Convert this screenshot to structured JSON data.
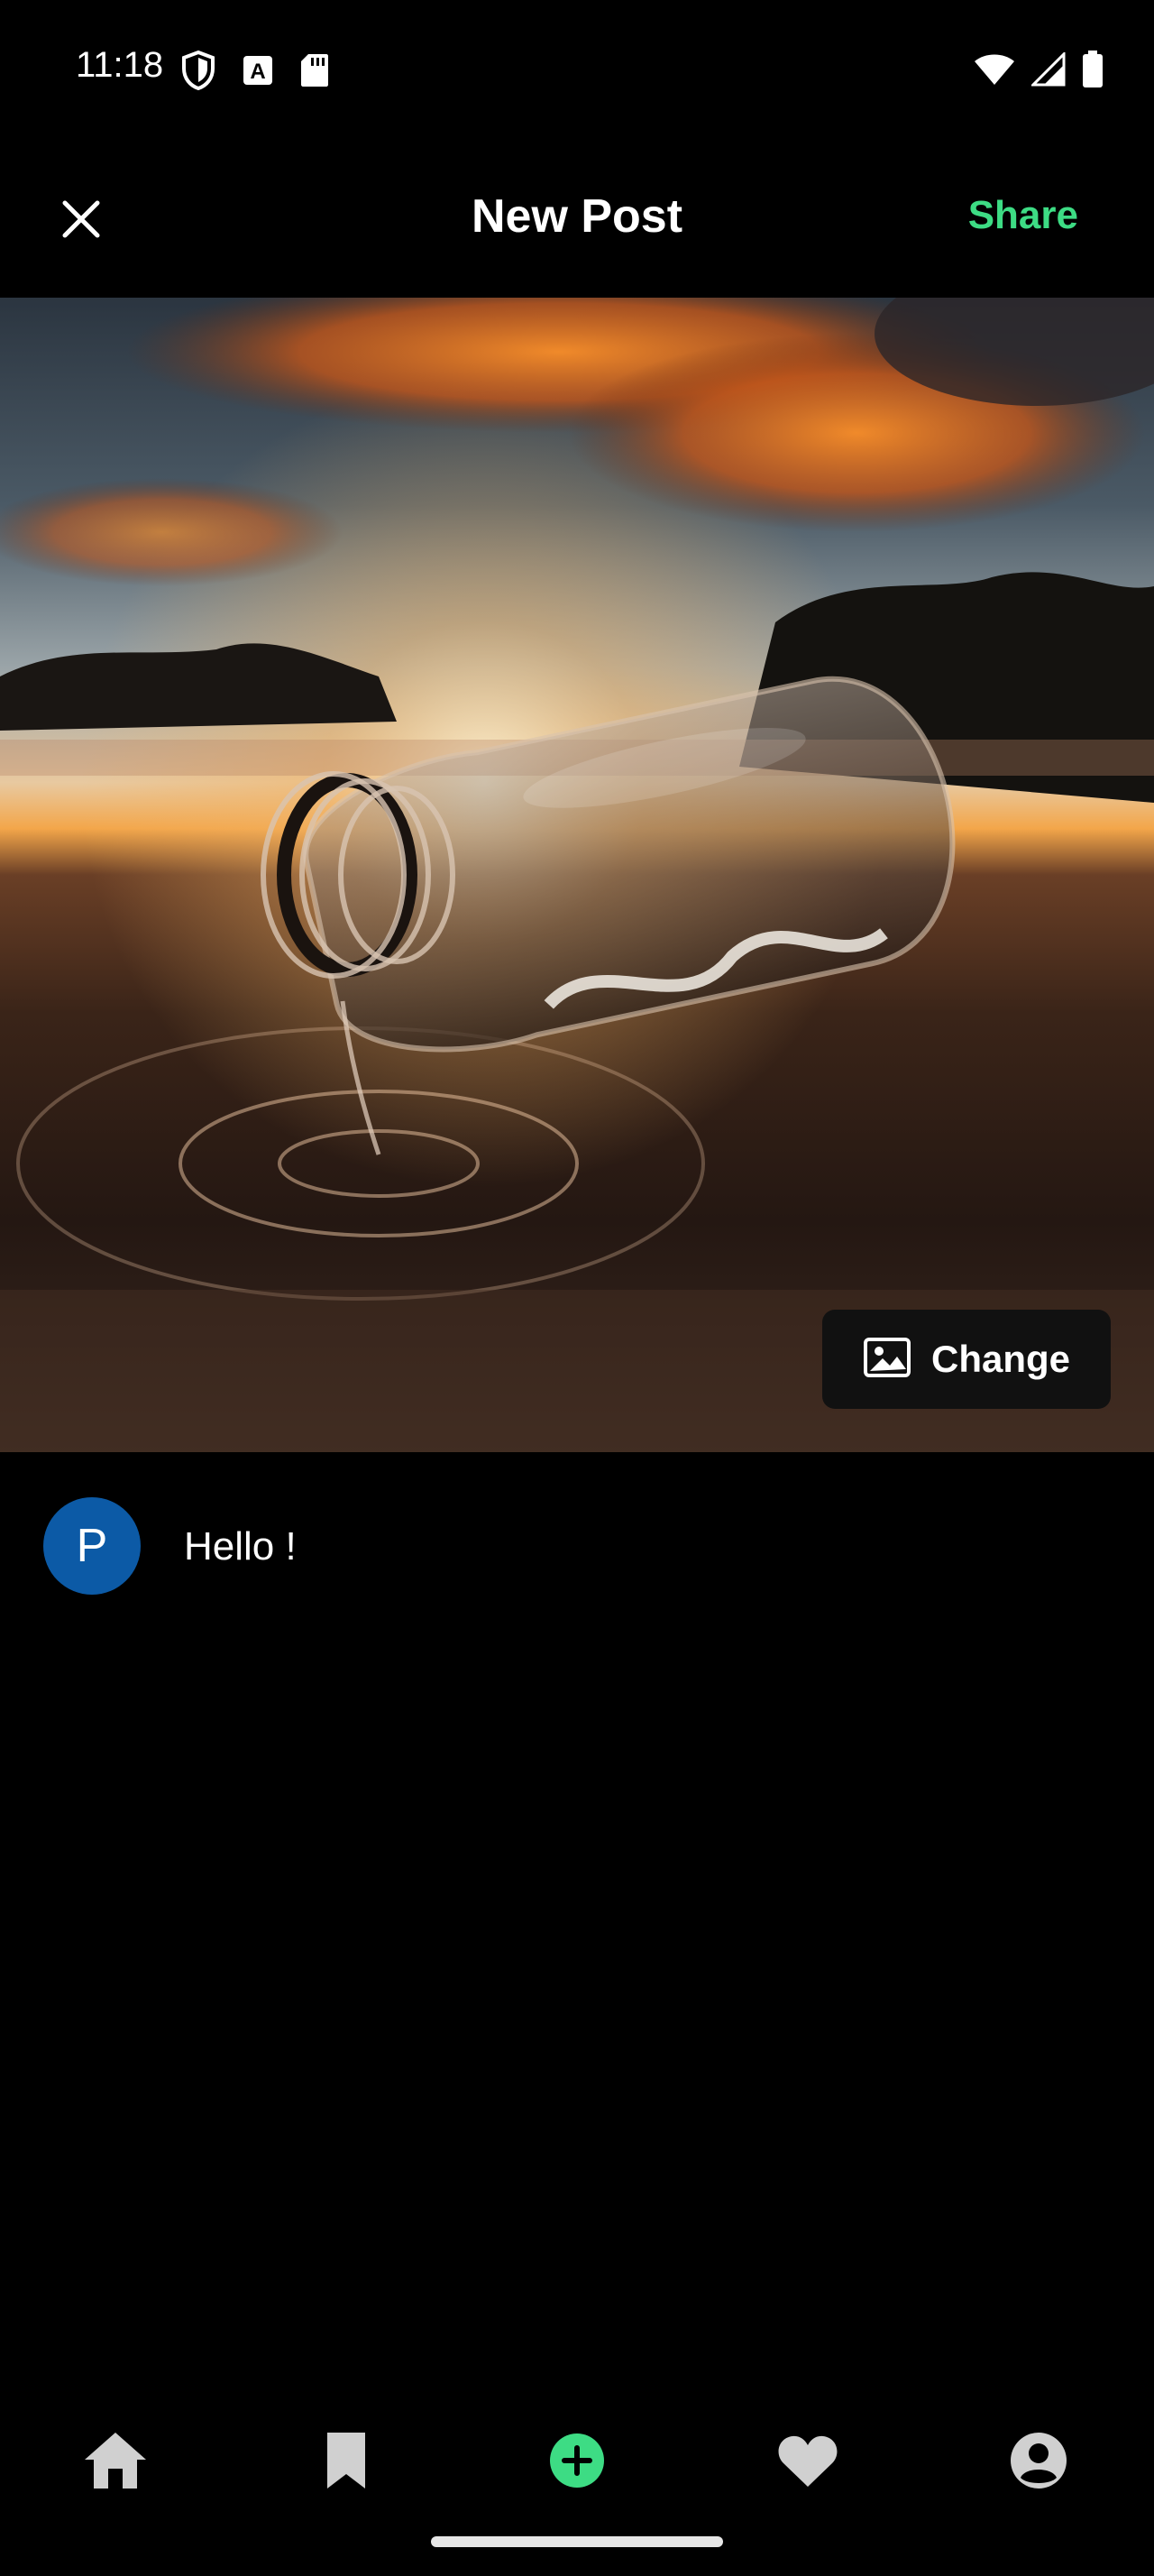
{
  "status_bar": {
    "time": "11:18",
    "left_icons": [
      "shield-icon",
      "keyboard-a-icon",
      "sd-card-icon"
    ],
    "right_icons": [
      "wifi-icon",
      "signal-icon",
      "battery-icon"
    ]
  },
  "app_bar": {
    "title": "New Post",
    "share_label": "Share",
    "share_color": "#3ddc84",
    "close_icon": "close-icon"
  },
  "photo": {
    "icon": "photo-bottle-sunset"
  },
  "change_button": {
    "label": "Change",
    "icon": "image-icon"
  },
  "composer": {
    "avatar_letter": "P",
    "avatar_color": "#0c5aa6",
    "caption": "Hello !"
  },
  "bottom_nav": {
    "items": [
      "home-icon",
      "bookmark-icon",
      "add-post-icon",
      "heart-icon",
      "profile-icon"
    ],
    "active": "add-post-icon",
    "active_color": "#3ddc84",
    "inactive_color": "#d0d0d0"
  }
}
